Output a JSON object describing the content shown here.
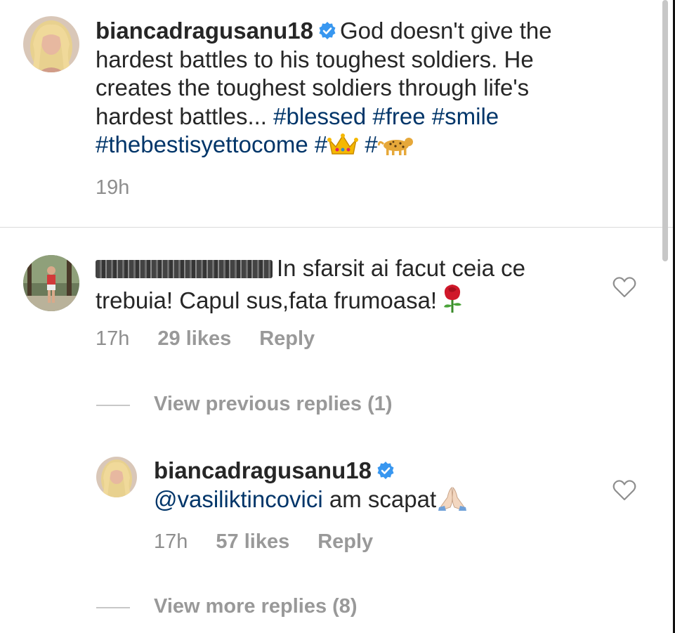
{
  "post": {
    "username": "biancadragusanu18",
    "caption": "God doesn't give the hardest battles to his toughest soldiers. He creates the toughest soldiers through life's hardest battles... ",
    "caption_line1": "God doesn't give the",
    "caption_line2": "hardest battles to his toughest soldiers. He",
    "caption_line3": "creates the toughest soldiers through life's",
    "caption_line4": "hardest battles... ",
    "tags_line4": "#blessed #free #smile",
    "tag_line5_a": "#thebestisyettocome #",
    "tag_line5_b": " #",
    "time": "19h"
  },
  "comment1": {
    "text_line1": "In sfarsit ai facut ceia ce",
    "text_line2": "trebuia! Capul sus,fata frumoasa!",
    "time": "17h",
    "likes": "29 likes",
    "reply_label": "Reply"
  },
  "view_previous": "View previous replies (1)",
  "reply1": {
    "username": "biancadragusanu18",
    "mention": "@vasiliktincovici",
    "text": " am scapat",
    "time": "17h",
    "likes": "57 likes",
    "reply_label": "Reply"
  },
  "view_more": "View more replies (8)",
  "colors": {
    "hashtag": "#003569",
    "verified": "#3897f0",
    "muted": "#8e8e8e"
  },
  "icons": [
    "verified-badge-icon",
    "crown-emoji",
    "leopard-emoji",
    "rose-emoji",
    "praying-hands-emoji",
    "heart-icon"
  ]
}
